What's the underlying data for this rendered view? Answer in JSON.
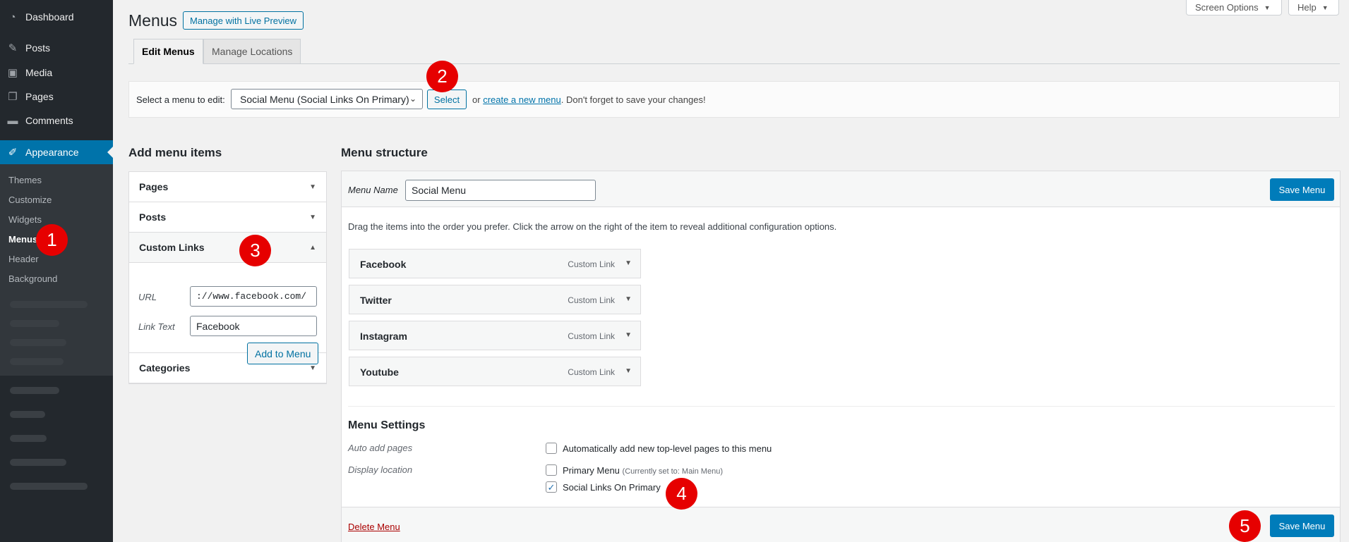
{
  "sidebar": {
    "items": [
      {
        "label": "Dashboard",
        "icon": "dashboard-icon"
      },
      {
        "label": "Posts",
        "icon": "pin-icon"
      },
      {
        "label": "Media",
        "icon": "media-icon"
      },
      {
        "label": "Pages",
        "icon": "pages-icon"
      },
      {
        "label": "Comments",
        "icon": "comment-icon"
      },
      {
        "label": "Appearance",
        "icon": "brush-icon"
      }
    ],
    "submenu": [
      "Themes",
      "Customize",
      "Widgets",
      "Menus",
      "Header",
      "Background"
    ]
  },
  "header": {
    "title": "Menus",
    "live_preview": "Manage with Live Preview",
    "screen_options": "Screen Options",
    "help": "Help"
  },
  "tabs": [
    "Edit Menus",
    "Manage Locations"
  ],
  "select_bar": {
    "label": "Select a menu to edit:",
    "selected": "Social Menu (Social Links On Primary)",
    "button": "Select",
    "or_text": "or",
    "create_link": "create a new menu",
    "tail": ". Don't forget to save your changes!"
  },
  "add_items": {
    "title": "Add menu items",
    "sections": [
      "Pages",
      "Posts",
      "Custom Links",
      "Categories"
    ],
    "url_label": "URL",
    "url_value": "://www.facebook.com/",
    "link_text_label": "Link Text",
    "link_text_value": "Facebook",
    "add_button": "Add to Menu"
  },
  "structure": {
    "title": "Menu structure",
    "menu_name_label": "Menu Name",
    "menu_name_value": "Social Menu",
    "save_label": "Save Menu",
    "instructions": "Drag the items into the order you prefer. Click the arrow on the right of the item to reveal additional configuration options.",
    "items": [
      {
        "title": "Facebook",
        "type": "Custom Link"
      },
      {
        "title": "Twitter",
        "type": "Custom Link"
      },
      {
        "title": "Instagram",
        "type": "Custom Link"
      },
      {
        "title": "Youtube",
        "type": "Custom Link"
      }
    ],
    "settings_title": "Menu Settings",
    "auto_add_label": "Auto add pages",
    "auto_add_option": "Automatically add new top-level pages to this menu",
    "display_location_label": "Display location",
    "primary_menu": "Primary Menu",
    "primary_note": "(Currently set to: Main Menu)",
    "social_links": "Social Links On Primary",
    "delete_label": "Delete Menu"
  },
  "markers": [
    "1",
    "2",
    "3",
    "4",
    "5"
  ],
  "colors": {
    "accent": "#0073aa",
    "sidebar": "#23282d",
    "marker": "#e60000",
    "primary_button": "#007cba"
  }
}
